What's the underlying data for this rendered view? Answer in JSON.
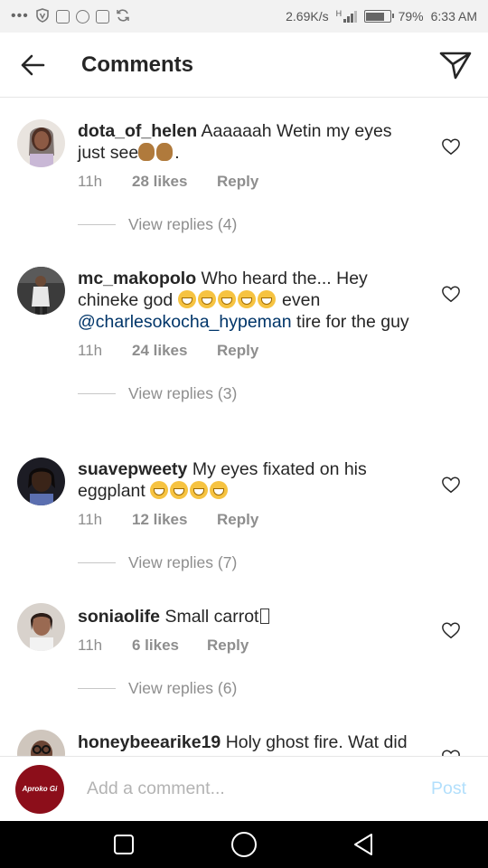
{
  "status_bar": {
    "left_icons": [
      "dots-icon",
      "vpn-icon",
      "gallery-icon",
      "whatsapp-icon",
      "instagram-icon",
      "sync-icon"
    ],
    "net_speed": "2.69K/s",
    "network_type": "H",
    "battery_percent": "79%",
    "battery_level": 0.79,
    "time": "6:33 AM"
  },
  "header": {
    "title": "Comments",
    "back_icon": "arrow-left-icon",
    "send_icon": "direct-send-icon"
  },
  "comments": [
    {
      "username": "dota_of_helen",
      "text": "Aaaaaah Wetin my eyes just see",
      "emoji": [
        "monkey",
        "monkey"
      ],
      "trailing": ".",
      "time": "11h",
      "likes": "28 likes",
      "reply": "Reply",
      "view_replies": "View replies (4)"
    },
    {
      "username": "mc_makopolo",
      "text": "Who heard the... Hey chineke god",
      "emoji": [
        "grin",
        "grin",
        "grin",
        "grin",
        "grin"
      ],
      "text_after": "even",
      "mention": "@charlesokocha_hypeman",
      "text_end": "tire for the guy",
      "time": "11h",
      "likes": "24 likes",
      "reply": "Reply",
      "view_replies": "View replies (3)"
    },
    {
      "username": "suavepweety",
      "text": "My eyes fixated on his eggplant",
      "emoji": [
        "grin",
        "grin",
        "grin",
        "grin"
      ],
      "time": "11h",
      "likes": "12 likes",
      "reply": "Reply",
      "view_replies": "View replies (7)"
    },
    {
      "username": "soniaolife",
      "text": "Small carrot",
      "time": "11h",
      "likes": "6 likes",
      "reply": "Reply",
      "view_replies": "View replies (6)"
    },
    {
      "username": "honeybeearike19",
      "text": "Holy ghost fire. Wat did"
    }
  ],
  "input_bar": {
    "avatar_text": "Aproko Gi",
    "placeholder": "Add a comment...",
    "post_label": "Post"
  },
  "colors": {
    "text": "#262626",
    "muted": "#8e8e8e",
    "mention": "#003569",
    "post_disabled": "#b2dffc",
    "avatar_brand": "#8c0e1a"
  }
}
